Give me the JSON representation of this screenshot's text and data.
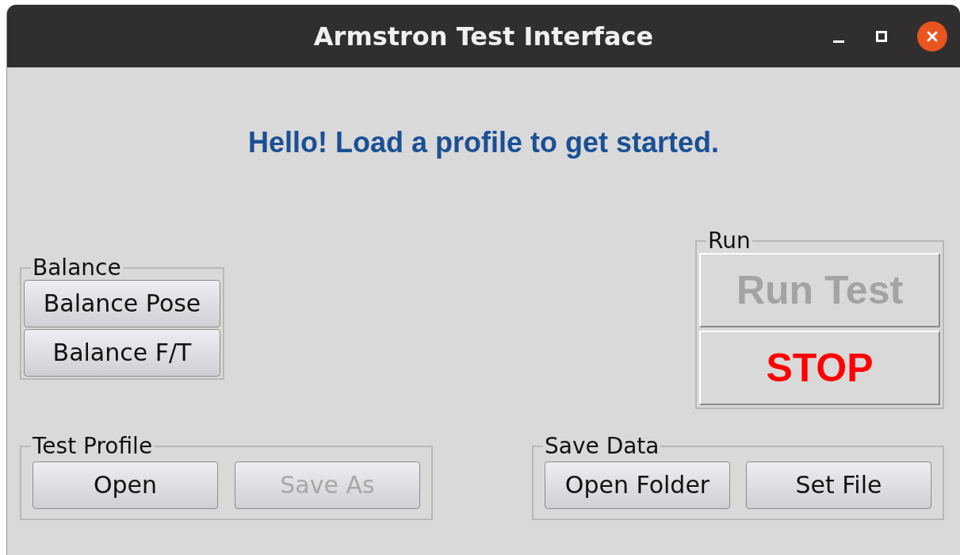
{
  "window": {
    "title": "Armstron Test Interface"
  },
  "message": "Hello! Load a profile to get started.",
  "groups": [
    {
      "legend": "Balance",
      "kind": "stack",
      "buttons": [
        {
          "label": "Balance Pose",
          "disabled": false
        },
        {
          "label": "Balance F/T",
          "disabled": false
        }
      ]
    },
    {
      "legend": "Run",
      "kind": "large",
      "buttons": [
        {
          "label": "Run Test",
          "disabled": true
        },
        {
          "label": "STOP",
          "disabled": false,
          "color": "#ff0000"
        }
      ]
    },
    {
      "legend": "Test Profile",
      "kind": "row",
      "buttons": [
        {
          "label": "Open",
          "disabled": false
        },
        {
          "label": "Save As",
          "disabled": true
        }
      ]
    },
    {
      "legend": "Save Data",
      "kind": "row",
      "buttons": [
        {
          "label": "Open Folder",
          "disabled": false
        },
        {
          "label": "Set File",
          "disabled": false
        }
      ]
    }
  ]
}
